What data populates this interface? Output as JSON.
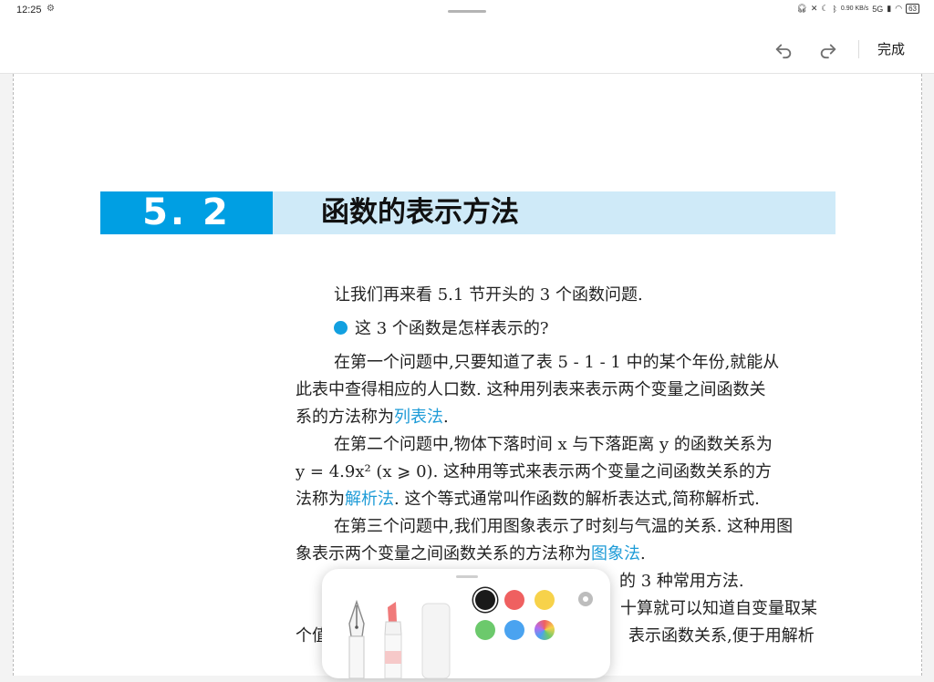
{
  "status_bar": {
    "time": "12:25",
    "network_speed": "0.90 KB/s",
    "signal": "5G",
    "battery": "63"
  },
  "toolbar": {
    "done_label": "完成"
  },
  "section": {
    "number": "5. 2",
    "title": "函数的表示方法"
  },
  "content": {
    "intro": "让我们再来看 5.1 节开头的 3 个函数问题.",
    "question": "这 3 个函数是怎样表示的?",
    "p1": {
      "l1": "在第一个问题中,只要知道了表 5 - 1 - 1 中的某个年份,就能从",
      "l2": "此表中查得相应的人口数. 这种用列表来表示两个变量之间函数关",
      "l3_pre": "系的方法称为",
      "l3_term": "列表法",
      "l3_post": "."
    },
    "p2": {
      "l1": "在第二个问题中,物体下落时间 x 与下落距离 y 的函数关系为",
      "l2": "y = 4.9x² (x ⩾ 0). 这种用等式来表示两个变量之间函数关系的方",
      "l3_pre": "法称为",
      "l3_term": "解析法",
      "l3_post": ". 这个等式通常叫作函数的解析表达式,简称解析式."
    },
    "p3": {
      "l1": "在第三个问题中,我们用图象表示了时刻与气温的关系. 这种用图",
      "l2_pre": "象表示两个变量之间函数关系的方法称为",
      "l2_term": "图象法",
      "l2_post": "."
    },
    "p4_fragment": "的 3 种常用方法.",
    "p5_fragment": "十算就可以知道自变量取某",
    "p6_fragment_left": "个值",
    "p6_fragment_right": "表示函数关系,便于用解析"
  },
  "pen_palette": {
    "tools": [
      "fountain-pen",
      "highlighter",
      "eraser"
    ],
    "colors": [
      "#1a1a1a",
      "#ef6060",
      "#f7d24a",
      "#6cc96c",
      "#4aa3f0",
      "multicolor"
    ],
    "selected_color": "#1a1a1a"
  }
}
